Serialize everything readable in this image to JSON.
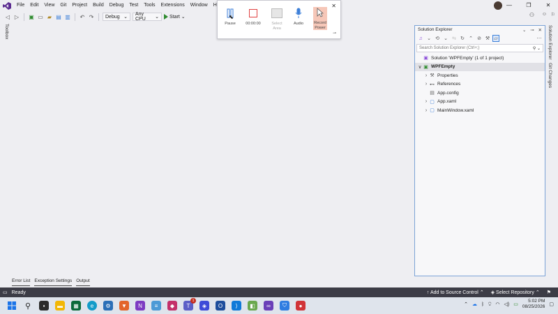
{
  "menu": [
    "File",
    "Edit",
    "View",
    "Git",
    "Project",
    "Build",
    "Debug",
    "Test",
    "Tools",
    "Extensions",
    "Window",
    "Help"
  ],
  "search_stub": "S",
  "toolbar": {
    "config": "Debug",
    "platform": "Any CPU",
    "start_label": "Start"
  },
  "side_tabs": {
    "toolbox": "Toolbox"
  },
  "recorder": {
    "pause_label": "Pause",
    "timer": "00:00:00",
    "select_area_label": "Select Area",
    "audio_label": "Audio",
    "record_power_label": "Record Power"
  },
  "solution_explorer": {
    "title": "Solution Explorer",
    "search_placeholder": "Search Solution Explorer (Ctrl+;)",
    "tree": [
      {
        "label": "Solution 'WPFEmpty' (1 of 1 project)",
        "icon": "solution-icon",
        "depth": 0,
        "chev": ""
      },
      {
        "label": "WPFEmpty",
        "icon": "csharp-project-icon",
        "depth": 0,
        "chev": "∨",
        "bold": true
      },
      {
        "label": "Properties",
        "icon": "wrench-icon",
        "depth": 1,
        "chev": "›"
      },
      {
        "label": "References",
        "icon": "references-icon",
        "depth": 1,
        "chev": "›"
      },
      {
        "label": "App.config",
        "icon": "config-file-icon",
        "depth": 1,
        "chev": ""
      },
      {
        "label": "App.xaml",
        "icon": "xaml-file-icon",
        "depth": 1,
        "chev": "›"
      },
      {
        "label": "MainWindow.xaml",
        "icon": "xaml-file-icon",
        "depth": 1,
        "chev": "›"
      }
    ]
  },
  "right_tabs": {
    "solution_explorer": "Solution Explorer",
    "git_changes": "Git Changes"
  },
  "bottom_tabs": [
    "Error List",
    "Exception Settings",
    "Output"
  ],
  "status": {
    "ready": "Ready",
    "source_control": "Add to Source Control",
    "repository": "Select Repository"
  },
  "clock": {
    "time": "5:02 PM",
    "date": "08/25/2026"
  },
  "taskbar_badge": "1",
  "colors": {
    "status_bar": "#3c3c46",
    "accent": "#3c7fd8",
    "record_power_bg": "#f6c7b8",
    "stop_red": "#e04040"
  }
}
